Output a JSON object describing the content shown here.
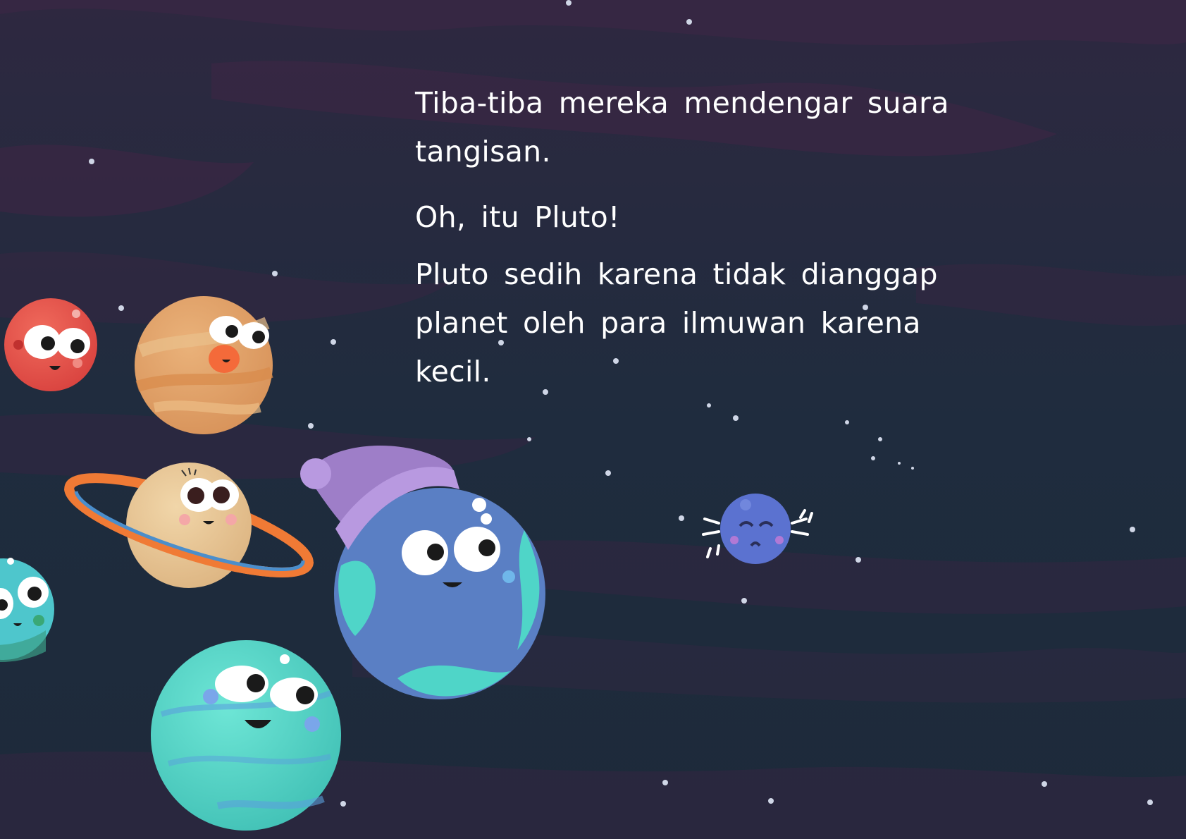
{
  "story": {
    "paragraphs": [
      "Tiba-tiba mereka mendengar suara tangisan.",
      "Oh, itu Pluto!",
      "Pluto sedih karena tidak dianggap planet oleh para ilmuwan karena kecil."
    ]
  },
  "colors": {
    "sky_dark": "#1f2a3c",
    "sky_band_purple": "#3b2847",
    "mars": "#e5514a",
    "jupiter": "#e3a463",
    "saturn": "#e9c796",
    "saturn_ring": "#f07a35",
    "earth_blue": "#5a7fc4",
    "earth_teal": "#4fd5c8",
    "hat_lavender": "#b092dc",
    "uranus_teal": "#48d0c4",
    "pluto": "#5b72d0"
  },
  "characters": {
    "mars": "happy-planet-icon",
    "jupiter": "happy-planet-icon",
    "saturn": "ringed-planet-icon",
    "earth": "planet-with-hat-icon",
    "uranus": "happy-planet-icon",
    "neptune": "partial-planet-icon",
    "pluto": "crying-dwarf-planet-icon"
  }
}
